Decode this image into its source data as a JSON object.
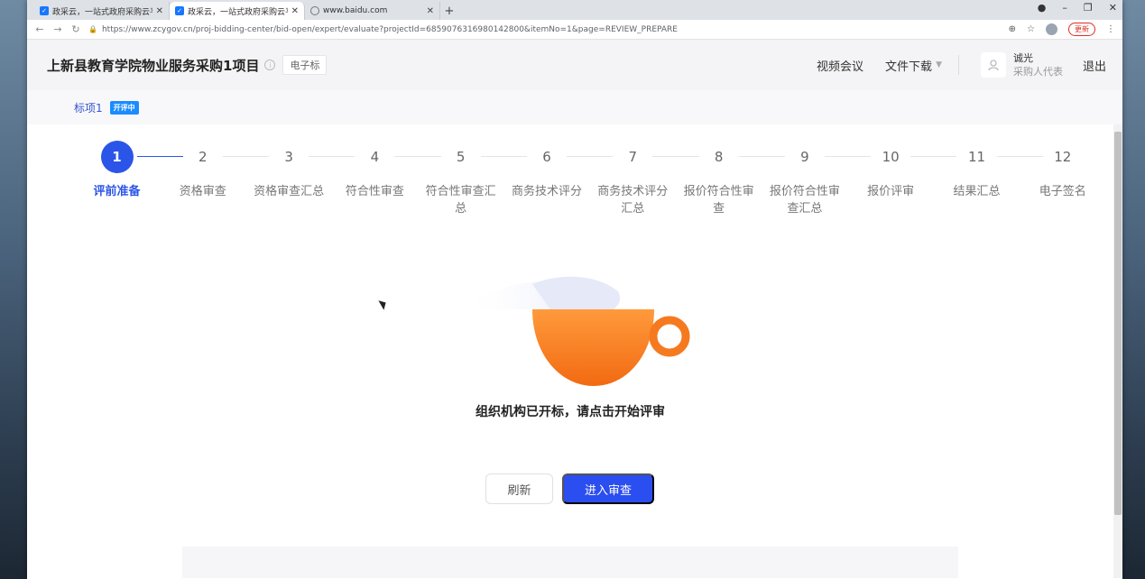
{
  "browser": {
    "tabs": [
      {
        "title": "政采云，一站式政府采购云平台",
        "active": false,
        "icon": "zcy-favicon"
      },
      {
        "title": "政采云，一站式政府采购云平台",
        "active": true,
        "icon": "zcy-favicon"
      },
      {
        "title": "www.baidu.com",
        "active": false,
        "icon": "globe-icon"
      }
    ],
    "new_tab": "+",
    "url": "https://www.zcygov.cn/proj-bidding-center/bid-open/expert/evaluate?projectId=6859076316980142800&itemNo=1&page=REVIEW_PREPARE",
    "update_label": "更新"
  },
  "header": {
    "title": "上新县教育学院物业服务采购1项目",
    "tag": "电子标",
    "video_meeting": "视频会议",
    "file_download": "文件下载",
    "user_name": "诚光",
    "user_role": "采购人代表",
    "logout": "退出"
  },
  "lot": {
    "name": "标项1",
    "badge": "开评中"
  },
  "steps": [
    {
      "num": "1",
      "label": "评前准备",
      "active": true
    },
    {
      "num": "2",
      "label": "资格审查",
      "active": false
    },
    {
      "num": "3",
      "label": "资格审查汇总",
      "active": false
    },
    {
      "num": "4",
      "label": "符合性审查",
      "active": false
    },
    {
      "num": "5",
      "label": "符合性审查汇总",
      "active": false
    },
    {
      "num": "6",
      "label": "商务技术评分",
      "active": false
    },
    {
      "num": "7",
      "label": "商务技术评分汇总",
      "active": false
    },
    {
      "num": "8",
      "label": "报价符合性审查",
      "active": false
    },
    {
      "num": "9",
      "label": "报价符合性审查汇总",
      "active": false
    },
    {
      "num": "10",
      "label": "报价评审",
      "active": false
    },
    {
      "num": "11",
      "label": "结果汇总",
      "active": false
    },
    {
      "num": "12",
      "label": "电子签名",
      "active": false
    }
  ],
  "main": {
    "message": "组织机构已开标，请点击开始评审",
    "refresh_label": "刷新",
    "enter_label": "进入审查"
  },
  "colors": {
    "primary": "#2b4ef0",
    "badge": "#1a8cff",
    "cup": "#f97a1f"
  }
}
